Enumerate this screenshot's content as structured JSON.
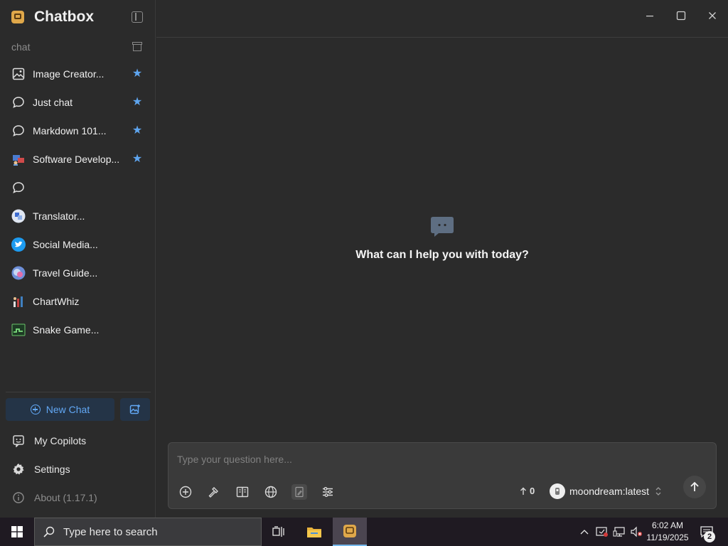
{
  "app": {
    "name": "Chatbox"
  },
  "sidebar": {
    "section_label": "chat",
    "items": [
      {
        "label": "Image Creator...",
        "icon": "image-icon",
        "starred": true
      },
      {
        "label": "Just chat",
        "icon": "chat-bubble-icon",
        "starred": true
      },
      {
        "label": "Markdown 101...",
        "icon": "chat-bubble-icon",
        "starred": true
      },
      {
        "label": "Software Develop...",
        "icon": "developer-avatar",
        "starred": true
      },
      {
        "label": "",
        "icon": "chat-bubble-icon",
        "starred": false
      },
      {
        "label": "Translator...",
        "icon": "translator-avatar",
        "starred": false
      },
      {
        "label": "Social Media...",
        "icon": "twitter-avatar",
        "starred": false
      },
      {
        "label": "Travel Guide...",
        "icon": "travel-avatar",
        "starred": false
      },
      {
        "label": "ChartWhiz",
        "icon": "chart-avatar",
        "starred": false
      },
      {
        "label": "Snake Game...",
        "icon": "snake-game-avatar",
        "starred": false
      }
    ],
    "new_chat_label": "New Chat",
    "my_copilots_label": "My Copilots",
    "settings_label": "Settings",
    "about_label": "About (1.17.1)"
  },
  "main": {
    "welcome_text": "What can I help you with today?",
    "composer": {
      "placeholder": "Type your question here...",
      "token_count": "0",
      "model_name": "moondream:latest"
    }
  },
  "taskbar": {
    "search_placeholder": "Type here to search",
    "time": "6:02 AM",
    "date": "11/19/2025",
    "notification_count": "2"
  },
  "colors": {
    "accent": "#62a8f5",
    "star": "#5ea5ef",
    "background": "#2b2b2b",
    "taskbar": "#1f1a22"
  }
}
